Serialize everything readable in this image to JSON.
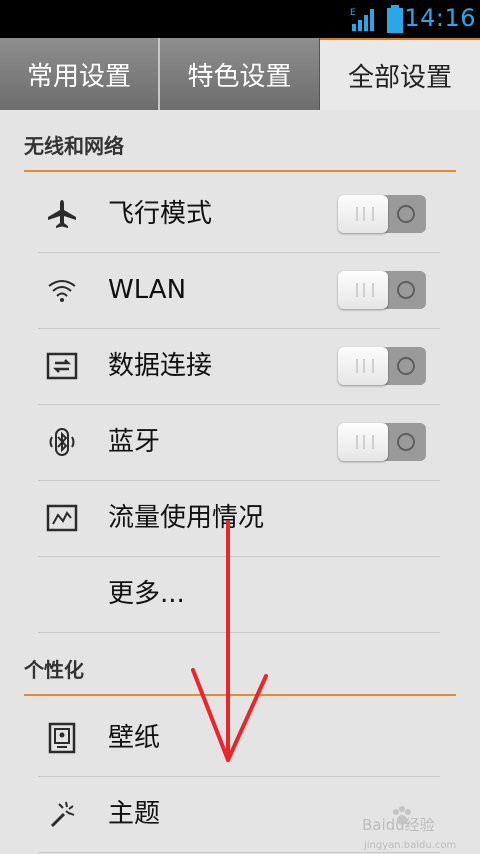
{
  "status_bar": {
    "time": "14:16",
    "network_type": "E",
    "accent_color": "#2aa7e8"
  },
  "tabs": [
    {
      "label": "常用设置"
    },
    {
      "label": "特色设置"
    },
    {
      "label": "全部设置",
      "active": true
    }
  ],
  "sections": [
    {
      "title": "无线和网络",
      "items": [
        {
          "label": "飞行模式",
          "icon": "airplane-icon",
          "toggle": "off"
        },
        {
          "label": "WLAN",
          "icon": "wifi-icon",
          "toggle": "off"
        },
        {
          "label": "数据连接",
          "icon": "data-connection-icon",
          "toggle": "off"
        },
        {
          "label": "蓝牙",
          "icon": "bluetooth-icon",
          "toggle": "off"
        },
        {
          "label": "流量使用情况",
          "icon": "data-usage-icon"
        },
        {
          "label": "更多..."
        }
      ]
    },
    {
      "title": "个性化",
      "items": [
        {
          "label": "壁纸",
          "icon": "wallpaper-icon"
        },
        {
          "label": "主题",
          "icon": "theme-icon"
        }
      ]
    }
  ],
  "watermark": {
    "text": "Baidu经验",
    "subtext": "jingyan.baidu.com"
  },
  "colors": {
    "section_line": "#f08a1e",
    "annotation_arrow": "#e8262b"
  }
}
